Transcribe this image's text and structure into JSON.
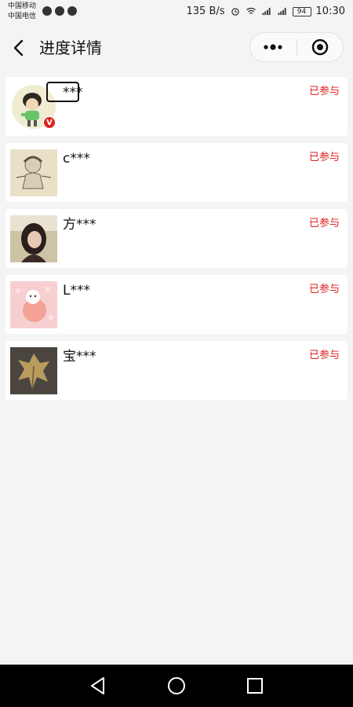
{
  "status_bar": {
    "carrier_1": "中国移动",
    "carrier_2": "中国电信",
    "speed": "135 B/s",
    "battery": "94",
    "time": "10:30"
  },
  "nav": {
    "title": "进度详情"
  },
  "participants": [
    {
      "name": "***",
      "status": "已参与",
      "verified_badge": "V"
    },
    {
      "name": "c***",
      "status": "已参与"
    },
    {
      "name": "方***",
      "status": "已参与"
    },
    {
      "name": "L***",
      "status": "已参与"
    },
    {
      "name": "宝***",
      "status": "已参与"
    }
  ],
  "colors": {
    "status_red": "#e02020",
    "background": "#f4f4f4",
    "card": "#ffffff"
  }
}
